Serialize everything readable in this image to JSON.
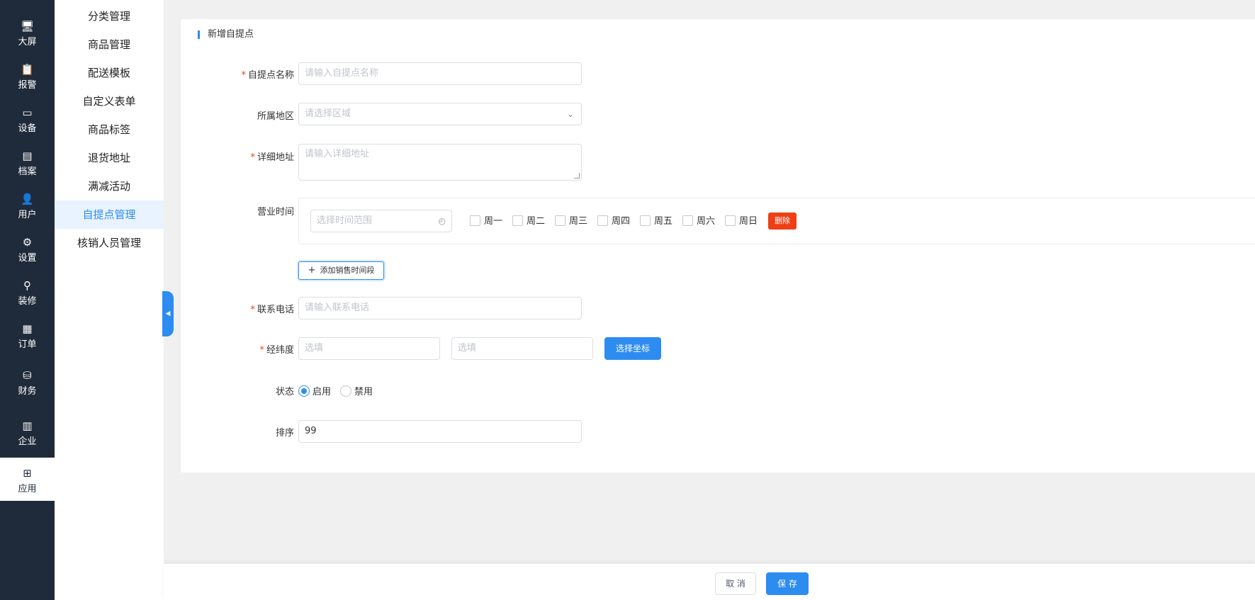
{
  "nav": [
    {
      "label": "大屏",
      "icon": "monitor-icon",
      "glyph": "🖥"
    },
    {
      "label": "报警",
      "icon": "clipboard-icon",
      "glyph": "📋"
    },
    {
      "label": "设备",
      "icon": "device-icon",
      "glyph": "▭"
    },
    {
      "label": "档案",
      "icon": "file-icon",
      "glyph": "▤"
    },
    {
      "label": "用户",
      "icon": "user-icon",
      "glyph": "👤"
    },
    {
      "label": "设置",
      "icon": "gear-icon",
      "glyph": "⚙"
    },
    {
      "label": "装修",
      "icon": "brush-icon",
      "glyph": "⚲"
    },
    {
      "label": "订单",
      "icon": "order-icon",
      "glyph": "▦"
    },
    {
      "label": "财务",
      "icon": "coins-icon",
      "glyph": "⛁"
    },
    {
      "label": "企业",
      "icon": "building-icon",
      "glyph": "▥"
    },
    {
      "label": "应用",
      "icon": "windows-icon",
      "glyph": "⊞"
    }
  ],
  "submenu": [
    "分类管理",
    "商品管理",
    "配送模板",
    "自定义表单",
    "商品标签",
    "退货地址",
    "满减活动",
    "自提点管理",
    "核销人员管理"
  ],
  "form": {
    "title": "新增自提点",
    "name_label": "自提点名称",
    "name_placeholder": "请输入自提点名称",
    "region_label": "所属地区",
    "region_placeholder": "请选择区域",
    "address_label": "详细地址",
    "address_placeholder": "请输入详细地址",
    "hours_label": "营业时间",
    "time_range_placeholder": "选择时间范围",
    "weekdays": [
      "周一",
      "周二",
      "周三",
      "周四",
      "周五",
      "周六",
      "周日"
    ],
    "delete_label": "删除",
    "add_period_label": "添加销售时间段",
    "phone_label": "联系电话",
    "phone_placeholder": "请输入联系电话",
    "coords_label": "经纬度",
    "lng_placeholder": "选填",
    "lat_placeholder": "选填",
    "pick_coords_label": "选择坐标",
    "status_label": "状态",
    "status_enabled": "启用",
    "status_disabled": "禁用",
    "sort_label": "排序",
    "sort_value": "99"
  },
  "footer": {
    "cancel": "取 消",
    "save": "保 存"
  },
  "colors": {
    "nav_bg": "#1f2a3a",
    "accent": "#2d8cf0",
    "danger": "#ed4014"
  }
}
